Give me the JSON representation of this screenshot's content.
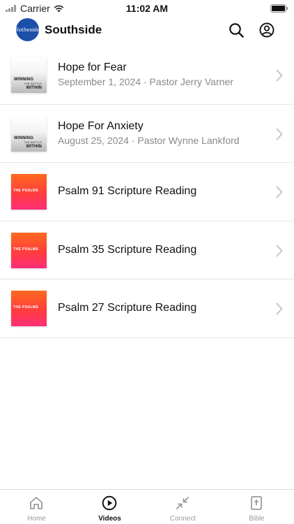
{
  "status_bar": {
    "carrier": "Carrier",
    "time": "11:02 AM"
  },
  "header": {
    "title": "Southside",
    "logo_text": "Sotheside"
  },
  "videos": [
    {
      "title": "Hope for Fear",
      "subtitle": "September 1, 2024 · Pastor Jerry Varner",
      "thumbnail": "winning-the-battle-within",
      "thumb_line1": "WINNING",
      "thumb_line2": "THE BATTLE",
      "thumb_line3": "WITHIN"
    },
    {
      "title": "Hope For Anxiety",
      "subtitle": "August 25, 2024 · Pastor Wynne Lankford",
      "thumbnail": "winning-the-battle-within",
      "thumb_line1": "WINNING",
      "thumb_line2": "THE BATTLE",
      "thumb_line3": "WITHIN"
    },
    {
      "title": "Psalm 91 Scripture Reading",
      "subtitle": "",
      "thumbnail": "the-psalms",
      "thumb_line1": "THE PSALMS"
    },
    {
      "title": "Psalm 35 Scripture Reading",
      "subtitle": "",
      "thumbnail": "the-psalms",
      "thumb_line1": "THE PSALMS"
    },
    {
      "title": "Psalm 27 Scripture Reading",
      "subtitle": "",
      "thumbnail": "the-psalms",
      "thumb_line1": "THE PSALMS"
    }
  ],
  "tabs": [
    {
      "label": "Home",
      "icon": "home-icon",
      "active": false
    },
    {
      "label": "Videos",
      "icon": "play-circle-icon",
      "active": true
    },
    {
      "label": "Connect",
      "icon": "connect-icon",
      "active": false
    },
    {
      "label": "Bible",
      "icon": "bible-icon",
      "active": false
    }
  ],
  "colors": {
    "accent": "#1b4fa8",
    "psalms_gradient": [
      "#ff6a1f",
      "#ff2e7a"
    ],
    "inactive": "#9a9a9a"
  }
}
